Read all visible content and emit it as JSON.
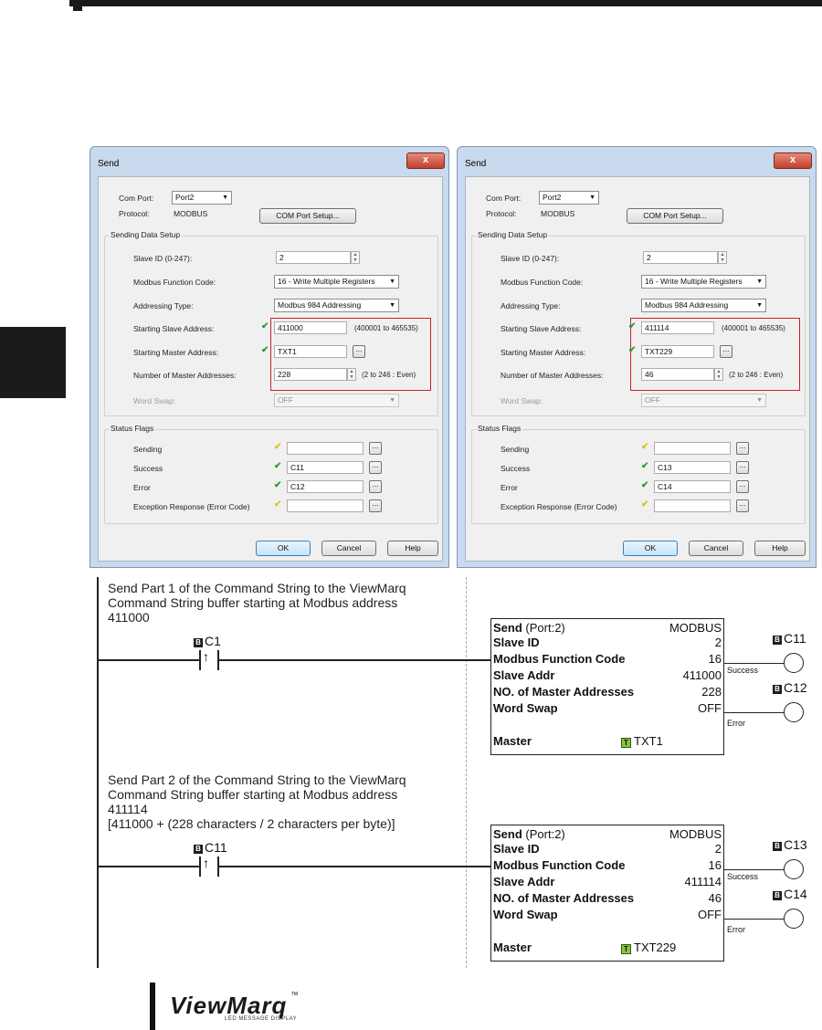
{
  "dialogs": [
    {
      "title": "Send",
      "close_glyph": "x",
      "com_port_label": "Com Port:",
      "com_port_value": "Port2",
      "protocol_label": "Protocol:",
      "protocol_value": "MODBUS",
      "com_setup_button": "COM Port Setup...",
      "sending_group": "Sending Data Setup",
      "slave_id_label": "Slave ID (0-247):",
      "slave_id_value": "2",
      "function_code_label": "Modbus Function Code:",
      "function_code_value": "16 - Write Multiple Registers",
      "addressing_label": "Addressing Type:",
      "addressing_value": "Modbus 984 Addressing",
      "start_slave_label": "Starting Slave Address:",
      "start_slave_value": "411000",
      "start_slave_range": "(400001 to 465535)",
      "start_master_label": "Starting Master Address:",
      "start_master_value": "TXT1",
      "num_master_label": "Number of Master Addresses:",
      "num_master_value": "228",
      "num_master_range": "(2 to 246 : Even)",
      "word_swap_label": "Word Swap:",
      "word_swap_value": "OFF",
      "status_group": "Status Flags",
      "sending_label": "Sending",
      "sending_value": "",
      "success_label": "Success",
      "success_value": "C11",
      "error_label": "Error",
      "error_value": "C12",
      "exception_label": "Exception Response (Error Code)",
      "exception_value": "",
      "ok_button": "OK",
      "cancel_button": "Cancel",
      "help_button": "Help",
      "ellipsis": "..."
    },
    {
      "title": "Send",
      "close_glyph": "x",
      "com_port_label": "Com Port:",
      "com_port_value": "Port2",
      "protocol_label": "Protocol:",
      "protocol_value": "MODBUS",
      "com_setup_button": "COM Port Setup...",
      "sending_group": "Sending Data Setup",
      "slave_id_label": "Slave ID (0-247):",
      "slave_id_value": "2",
      "function_code_label": "Modbus Function Code:",
      "function_code_value": "16 - Write Multiple Registers",
      "addressing_label": "Addressing Type:",
      "addressing_value": "Modbus 984 Addressing",
      "start_slave_label": "Starting Slave Address:",
      "start_slave_value": "411114",
      "start_slave_range": "(400001 to 465535)",
      "start_master_label": "Starting Master Address:",
      "start_master_value": "TXT229",
      "num_master_label": "Number of Master Addresses:",
      "num_master_value": "46",
      "num_master_range": "(2 to 246 : Even)",
      "word_swap_label": "Word Swap:",
      "word_swap_value": "OFF",
      "status_group": "Status Flags",
      "sending_label": "Sending",
      "sending_value": "",
      "success_label": "Success",
      "success_value": "C13",
      "error_label": "Error",
      "error_value": "C14",
      "exception_label": "Exception Response (Error Code)",
      "exception_value": "",
      "ok_button": "OK",
      "cancel_button": "Cancel",
      "help_button": "Help",
      "ellipsis": "..."
    }
  ],
  "rungs": [
    {
      "comment": "Send Part 1 of the Command String to the ViewMarq\nCommand String buffer starting at Modbus address\n411000",
      "contact": "C1",
      "block": {
        "title": "Send",
        "port": "(Port:2)",
        "protocol": "MODBUS",
        "slave_id_label": "Slave ID",
        "slave_id": "2",
        "function_label": "Modbus Function Code",
        "function": "16",
        "slave_addr_label": "Slave Addr",
        "slave_addr": "411000",
        "num_label": "NO. of Master Addresses",
        "num": "228",
        "swap_label": "Word Swap",
        "swap": "OFF",
        "master_label": "Master",
        "master": "TXT1"
      },
      "success_coil": "C11",
      "error_coil": "C12",
      "success_label": "Success",
      "error_label": "Error"
    },
    {
      "comment": "Send Part 2 of the Command String to the ViewMarq\nCommand String buffer starting at Modbus address\n411114\n[411000 + (228 characters / 2 characters per byte)]",
      "contact": "C11",
      "block": {
        "title": "Send",
        "port": "(Port:2)",
        "protocol": "MODBUS",
        "slave_id_label": "Slave ID",
        "slave_id": "2",
        "function_label": "Modbus Function Code",
        "function": "16",
        "slave_addr_label": "Slave Addr",
        "slave_addr": "411114",
        "num_label": "NO. of Master Addresses",
        "num": "46",
        "swap_label": "Word Swap",
        "swap": "OFF",
        "master_label": "Master",
        "master": "TXT229"
      },
      "success_coil": "C13",
      "error_coil": "C14",
      "success_label": "Success",
      "error_label": "Error"
    }
  ],
  "icons": {
    "bit": "B",
    "text": "T",
    "check": "✔",
    "contact": "↑"
  },
  "footer": {
    "logo_text": "ViewMarq",
    "logo_tagline": "LED MESSAGE DISPLAY",
    "tm": "TM"
  },
  "colors": {
    "check_green": "#2b9b2b",
    "check_yellow": "#d9c31c",
    "highlight_red": "#c8202a",
    "title_bar": "#c9d9ee"
  }
}
